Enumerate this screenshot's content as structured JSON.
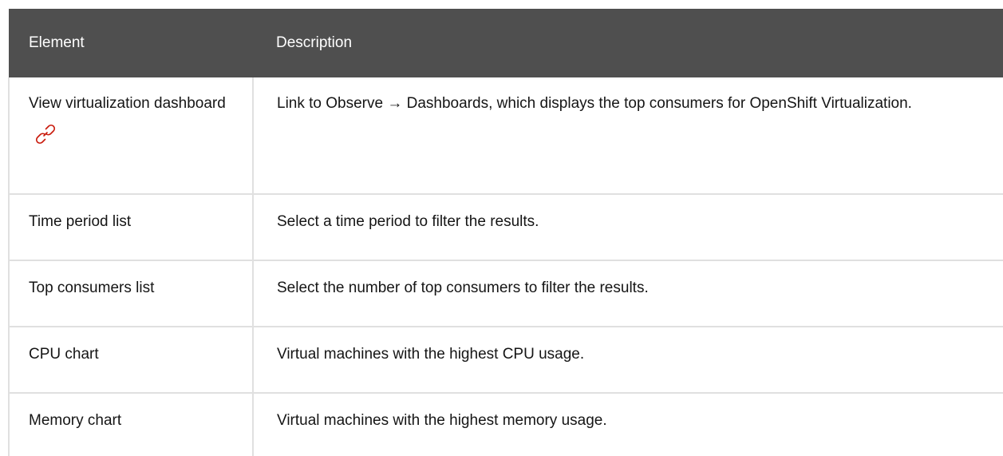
{
  "table": {
    "headers": [
      "Element",
      "Description"
    ],
    "rows": [
      {
        "element_bold": "View virtualization dashboard",
        "element_rest": "",
        "has_link_icon": true,
        "desc_prefix": "Link to ",
        "desc_bold": "Observe → Dashboards",
        "desc_suffix": ", which displays the top consumers for OpenShift Virtualization."
      },
      {
        "element_bold": "Time period",
        "element_rest": " list",
        "desc": "Select a time period to filter the results."
      },
      {
        "element_bold": "Top consumers",
        "element_rest": " list",
        "desc": "Select the number of top consumers to filter the results."
      },
      {
        "element_bold": "CPU",
        "element_rest": " chart",
        "desc": "Virtual machines with the highest CPU usage."
      },
      {
        "element_bold": "Memory",
        "element_rest": " chart",
        "desc": "Virtual machines with the highest memory usage."
      }
    ],
    "colors": {
      "header_bg": "#4f4f4f",
      "header_text": "#ffffff",
      "border": "#e0e0e0",
      "link_icon": "#c9190b"
    },
    "icons": [
      "link-icon"
    ]
  }
}
